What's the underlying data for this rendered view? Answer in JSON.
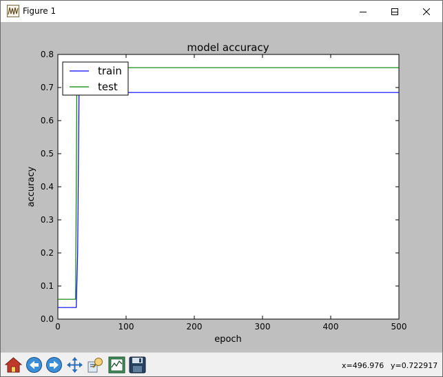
{
  "window": {
    "title": "Figure 1"
  },
  "titlebar_buttons": {
    "minimize_icon": "minimize-icon",
    "maximize_icon": "maximize-icon",
    "close_icon": "close-icon"
  },
  "toolbar": {
    "buttons": [
      "home-icon",
      "back-icon",
      "forward-icon",
      "pan-icon",
      "zoom-icon",
      "subplots-icon",
      "save-icon"
    ],
    "x_readout": "x=496.976",
    "y_readout": "y=0.722917"
  },
  "chart_data": {
    "type": "line",
    "title": "model accuracy",
    "xlabel": "epoch",
    "ylabel": "accuracy",
    "xlim": [
      0,
      500
    ],
    "ylim": [
      0.0,
      0.8
    ],
    "x_ticks": [
      "0",
      "100",
      "200",
      "300",
      "400",
      "500"
    ],
    "y_ticks": [
      "0.0",
      "0.1",
      "0.2",
      "0.3",
      "0.4",
      "0.5",
      "0.6",
      "0.7",
      "0.8"
    ],
    "grid": false,
    "legend_position": "top-left",
    "series": [
      {
        "name": "train",
        "color": "#0000ff",
        "x": [
          0,
          27,
          29,
          31,
          500
        ],
        "y": [
          0.035,
          0.035,
          0.2,
          0.685,
          0.685
        ]
      },
      {
        "name": "test",
        "color": "#008000",
        "x": [
          0,
          26,
          28,
          500
        ],
        "y": [
          0.06,
          0.06,
          0.76,
          0.76
        ]
      }
    ]
  }
}
